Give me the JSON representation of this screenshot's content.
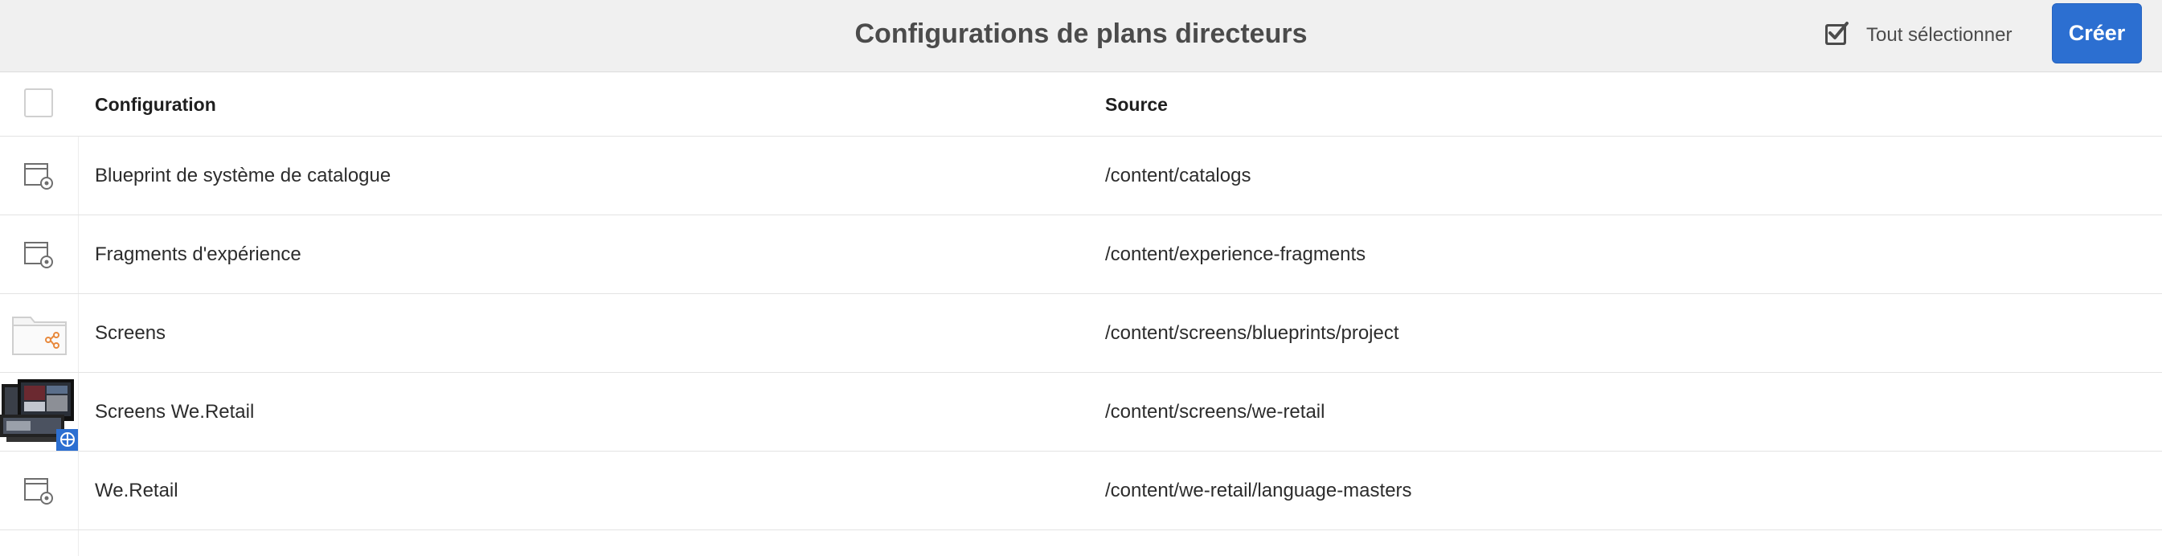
{
  "header": {
    "title": "Configurations de plans directeurs",
    "select_all_label": "Tout sélectionner",
    "create_label": "Créer"
  },
  "table": {
    "columns": [
      "Configuration",
      "Source"
    ],
    "rows": [
      {
        "configuration": "Blueprint de système de catalogue",
        "source": "/content/catalogs",
        "icon": "page-gear-icon"
      },
      {
        "configuration": "Fragments d'expérience",
        "source": "/content/experience-fragments",
        "icon": "page-gear-icon"
      },
      {
        "configuration": "Screens",
        "source": "/content/screens/blueprints/project",
        "icon": "folder-share-icon"
      },
      {
        "configuration": "Screens We.Retail",
        "source": "/content/screens/we-retail",
        "icon": "screens-thumbnail"
      },
      {
        "configuration": "We.Retail",
        "source": "/content/we-retail/language-masters",
        "icon": "page-gear-icon"
      }
    ]
  },
  "colors": {
    "accent": "#2c6fd1",
    "topbar": "#f0f0f0"
  }
}
